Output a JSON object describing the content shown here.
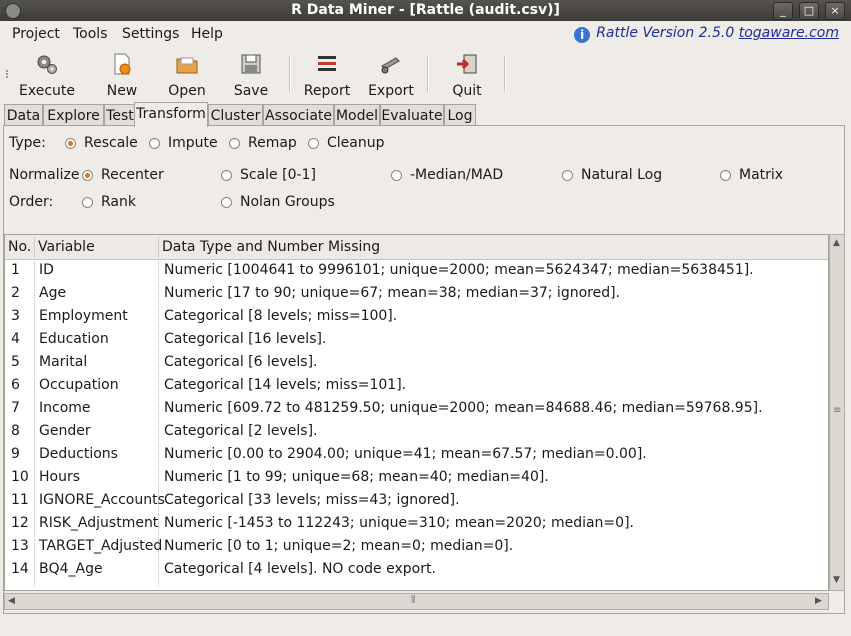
{
  "window": {
    "title": "R Data Miner - [Rattle (audit.csv)]",
    "controls": [
      "_",
      "□",
      "×"
    ]
  },
  "menubar": {
    "items": [
      "Project",
      "Tools",
      "Settings",
      "Help"
    ],
    "version_label": "Rattle Version 2.5.0",
    "version_link": "togaware.com"
  },
  "toolbar": {
    "execute": "Execute",
    "new": "New",
    "open": "Open",
    "save": "Save",
    "report": "Report",
    "export": "Export",
    "quit": "Quit"
  },
  "tabs": [
    "Data",
    "Explore",
    "Test",
    "Transform",
    "Cluster",
    "Associate",
    "Model",
    "Evaluate",
    "Log"
  ],
  "active_tab": "Transform",
  "transform": {
    "type_label": "Type:",
    "type_options": [
      "Rescale",
      "Impute",
      "Remap",
      "Cleanup"
    ],
    "type_selected": "Rescale",
    "normalize_label": "Normalize",
    "normalize_options": [
      "Recenter",
      "Scale [0-1]",
      "-Median/MAD",
      "Natural Log",
      "Matrix"
    ],
    "normalize_selected": "Recenter",
    "order_label": "Order:",
    "order_options": [
      "Rank",
      "Nolan Groups"
    ]
  },
  "table": {
    "headers": [
      "No.",
      "Variable",
      "Data Type and Number Missing"
    ],
    "rows": [
      {
        "no": "1",
        "var": "ID",
        "desc": "Numeric [1004641 to 9996101; unique=2000; mean=5624347; median=5638451]."
      },
      {
        "no": "2",
        "var": "Age",
        "desc": "Numeric [17 to 90; unique=67; mean=38; median=37; ignored]."
      },
      {
        "no": "3",
        "var": "Employment",
        "desc": "Categorical [8 levels; miss=100]."
      },
      {
        "no": "4",
        "var": "Education",
        "desc": "Categorical [16 levels]."
      },
      {
        "no": "5",
        "var": "Marital",
        "desc": "Categorical [6 levels]."
      },
      {
        "no": "6",
        "var": "Occupation",
        "desc": "Categorical [14 levels; miss=101]."
      },
      {
        "no": "7",
        "var": "Income",
        "desc": "Numeric [609.72 to 481259.50; unique=2000; mean=84688.46; median=59768.95]."
      },
      {
        "no": "8",
        "var": "Gender",
        "desc": "Categorical [2 levels]."
      },
      {
        "no": "9",
        "var": "Deductions",
        "desc": "Numeric [0.00 to 2904.00; unique=41; mean=67.57; median=0.00]."
      },
      {
        "no": "10",
        "var": "Hours",
        "desc": "Numeric [1 to 99; unique=68; mean=40; median=40]."
      },
      {
        "no": "11",
        "var": "IGNORE_Accounts",
        "desc": "Categorical [33 levels; miss=43; ignored]."
      },
      {
        "no": "12",
        "var": "RISK_Adjustment",
        "desc": "Numeric [-1453 to 112243; unique=310; mean=2020; median=0]."
      },
      {
        "no": "13",
        "var": "TARGET_Adjusted",
        "desc": "Numeric [0 to 1; unique=2; mean=0; median=0]."
      },
      {
        "no": "14",
        "var": "BQ4_Age",
        "desc": "Categorical [4 levels]. NO code export."
      }
    ]
  },
  "colors": {
    "title_bg": "#3c3b37",
    "accent_radio": "#d27a1e",
    "link": "#1d2d9c"
  }
}
